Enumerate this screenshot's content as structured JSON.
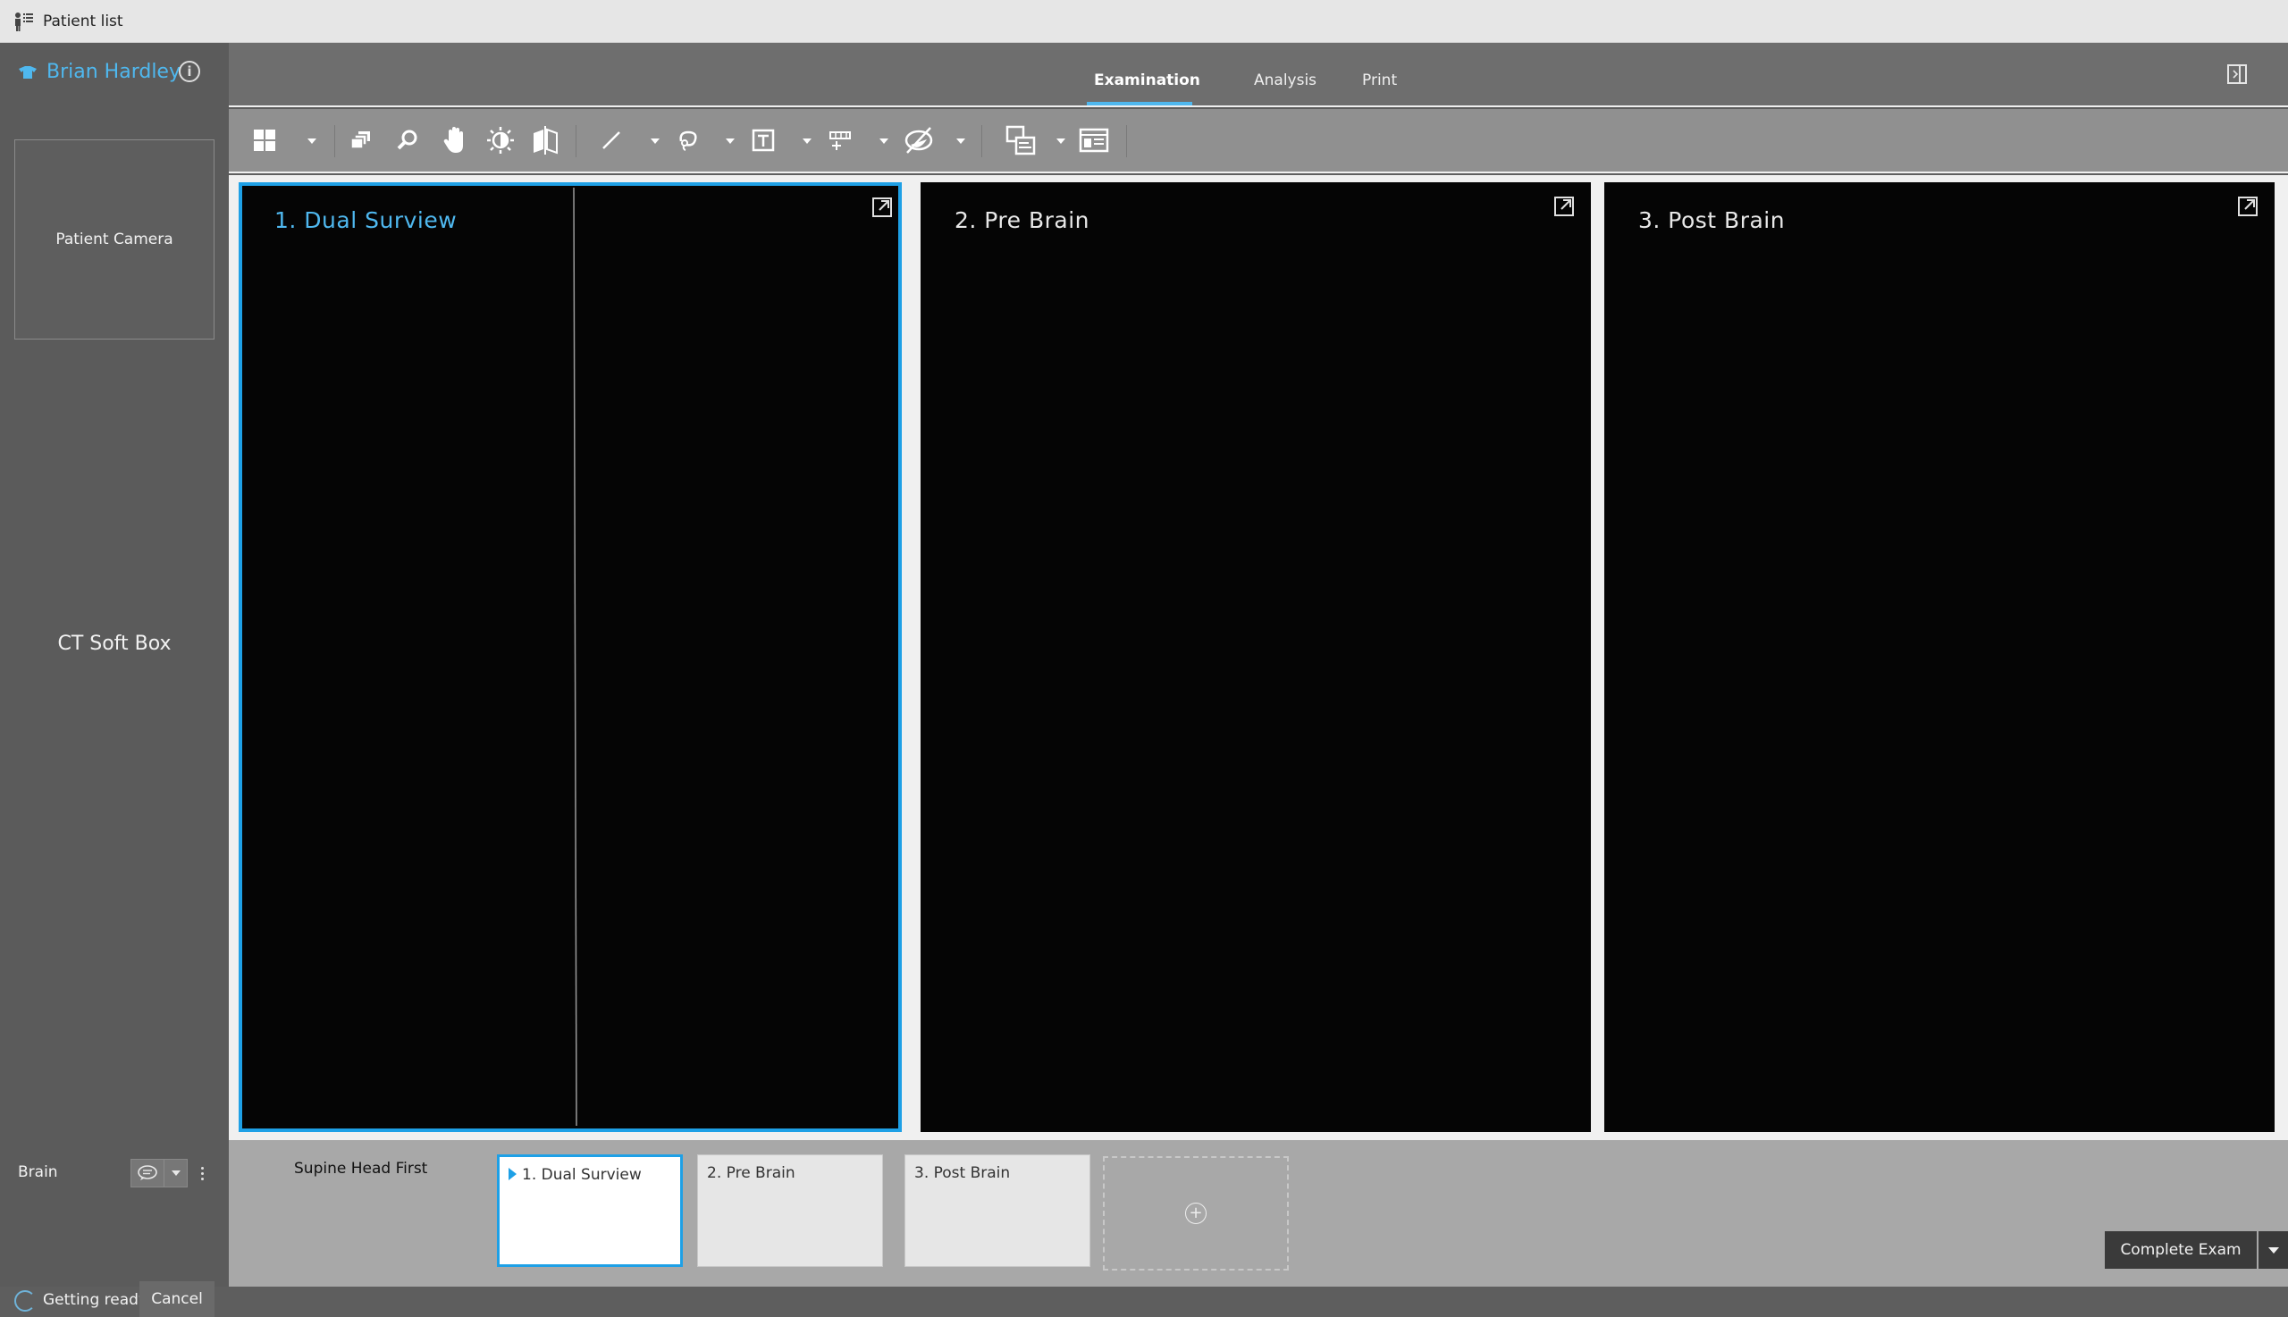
{
  "topbar": {
    "patient_list_label": "Patient list",
    "icon": "patient-list-icon"
  },
  "patient": {
    "name": "Brian Hardley",
    "info_label": "i"
  },
  "left_panel": {
    "camera_label": "Patient Camera",
    "protocol_label": "CT Soft Box",
    "region_label": "Brain",
    "status_label": "Getting ready",
    "cancel_label": "Cancel"
  },
  "tabs": [
    {
      "label": "Examination",
      "active": true
    },
    {
      "label": "Analysis",
      "active": false
    },
    {
      "label": "Print",
      "active": false
    }
  ],
  "viewports": [
    {
      "title": "1. Dual Surview",
      "selected": true
    },
    {
      "title": "2. Pre Brain",
      "selected": false
    },
    {
      "title": "3. Post Brain",
      "selected": false
    }
  ],
  "bottom": {
    "position_label": "Supine Head First",
    "series_cards": [
      {
        "label": "1. Dual Surview",
        "selected": true
      },
      {
        "label": "2. Pre Brain",
        "selected": false
      },
      {
        "label": "3. Post Brain",
        "selected": false
      }
    ],
    "add_label": "+",
    "complete_label": "Complete Exam"
  },
  "colors": {
    "accent": "#1ea0e6",
    "name": "#4fb8ef",
    "viewport_bg": "#050505"
  }
}
